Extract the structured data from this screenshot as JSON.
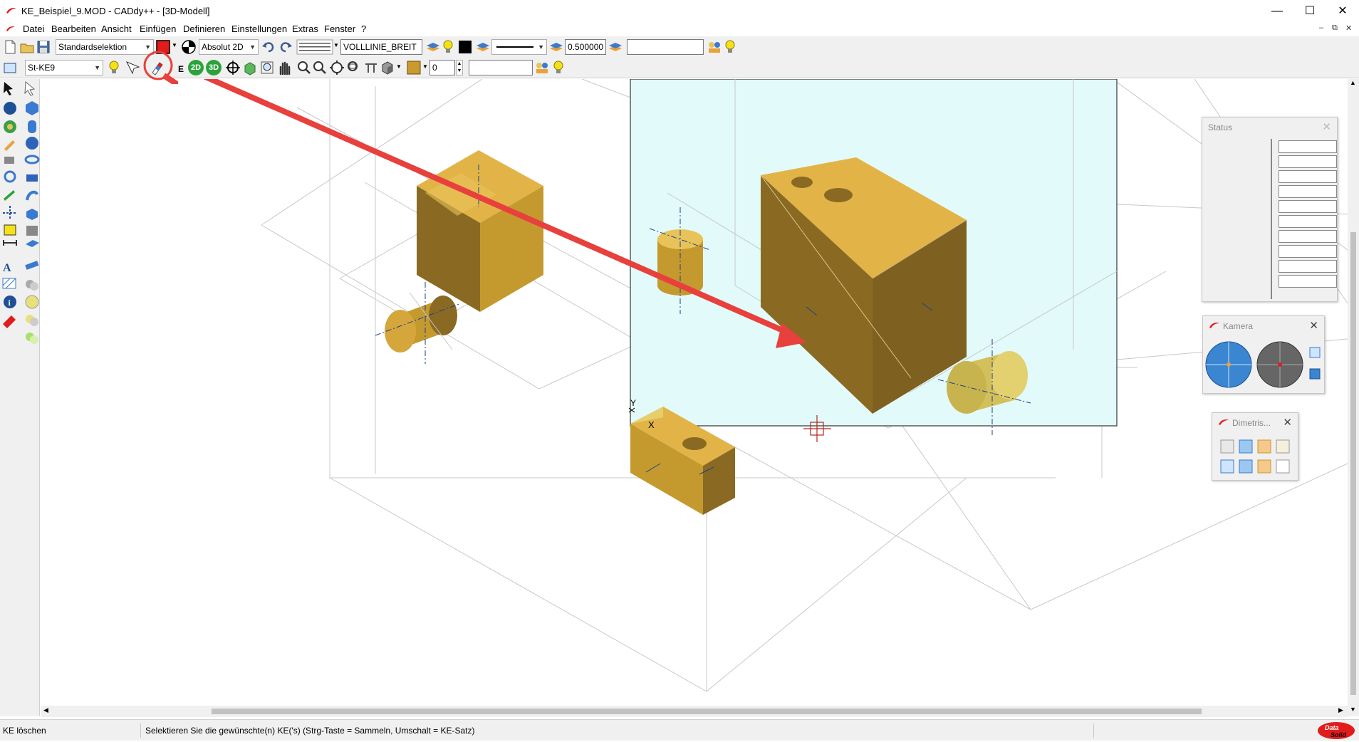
{
  "window": {
    "title": "KE_Beispiel_9.MOD  -  CADdy++ - [3D-Modell]",
    "minimize": "—",
    "maximize": "☐",
    "close": "✕"
  },
  "menu": [
    "Datei",
    "Bearbeiten",
    "Ansicht",
    "Einfügen",
    "Definieren",
    "Einstellungen",
    "Extras",
    "Fenster",
    "?"
  ],
  "mdi_buttons": [
    "–",
    "⧉",
    "✕"
  ],
  "toolbar1": {
    "selection_mode": "Standardselektion",
    "coord_mode": "Absolut 2D",
    "line_type": "VOLLLINIE_BREIT",
    "line_width": "0.500000",
    "text_field": ""
  },
  "toolbar2": {
    "layer": "St-KE9",
    "btn_2d": "2D",
    "btn_3d": "3D",
    "label_e": "E",
    "counter": "0",
    "text_field": ""
  },
  "canvas": {
    "axis_y": "Y",
    "axis_x": "X"
  },
  "panels": {
    "status": {
      "title": "Status",
      "close": "✕",
      "rows": 10
    },
    "camera": {
      "title": "Kamera",
      "close": "✕"
    },
    "dimetric": {
      "title": "Dimetris...",
      "close": "✕"
    }
  },
  "statusbar": {
    "command": "KE löschen",
    "prompt": "Selektieren Sie die gewünschte(n) KE('s) (Strg-Taste = Sammeln, Umschalt = KE-Satz)",
    "brand_line1": "Data",
    "brand_line2": "Solid"
  },
  "colors": {
    "accent_red": "#e21b1b",
    "solid_top": "#e2b447",
    "solid_front": "#c49a2f",
    "solid_side": "#8a6a22",
    "work_plane": "#e2fafa",
    "annotation_arrow": "#e8403c",
    "construction_line": "#c8c8c8"
  }
}
